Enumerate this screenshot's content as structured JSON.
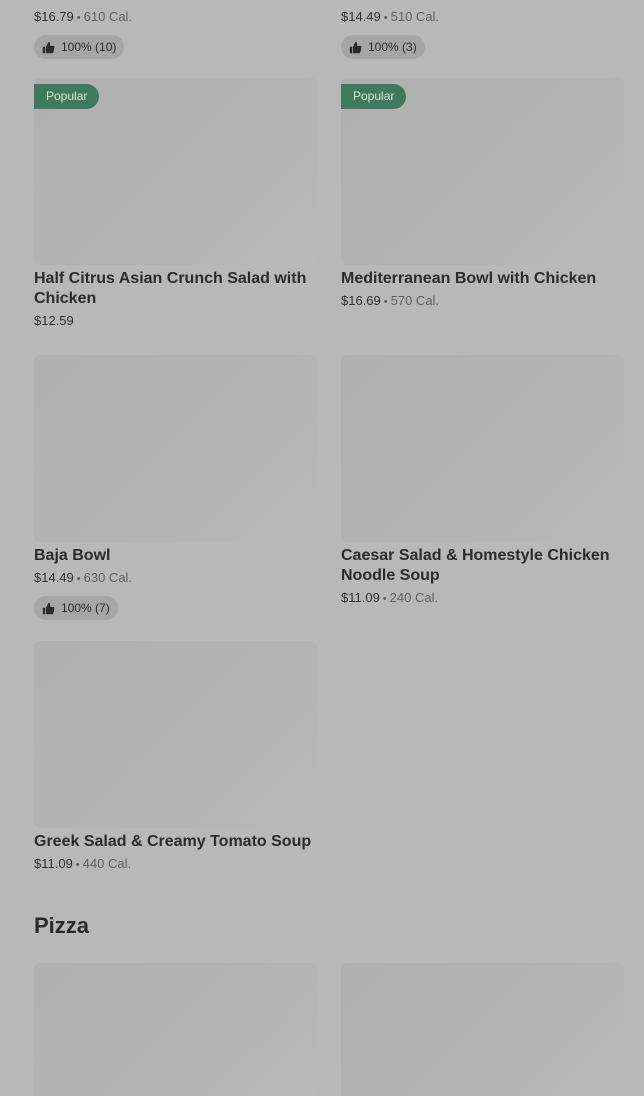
{
  "top_row": [
    {
      "price": "$16.79",
      "calories": "610 Cal.",
      "rating": "100% (10)"
    },
    {
      "price": "$14.49",
      "calories": "510 Cal.",
      "rating": "100% (3)"
    }
  ],
  "items": [
    {
      "badge": "Popular",
      "name": "Half Citrus Asian Crunch Salad with Chicken",
      "price": "$12.59"
    },
    {
      "badge": "Popular",
      "name": "Mediterranean Bowl with Chicken",
      "price": "$16.69",
      "calories": "570 Cal."
    },
    {
      "name": "Baja Bowl",
      "price": "$14.49",
      "calories": "630 Cal.",
      "rating": "100% (7)"
    },
    {
      "name": "Caesar Salad & Homestyle Chicken Noodle Soup",
      "price": "$11.09",
      "calories": "240 Cal."
    },
    {
      "name": "Greek Salad & Creamy Tomato Soup",
      "price": "$11.09",
      "calories": "440 Cal."
    }
  ],
  "separator": "•",
  "section": {
    "title": "Pizza"
  },
  "icons": {
    "rating": "thumbs-up-icon"
  }
}
